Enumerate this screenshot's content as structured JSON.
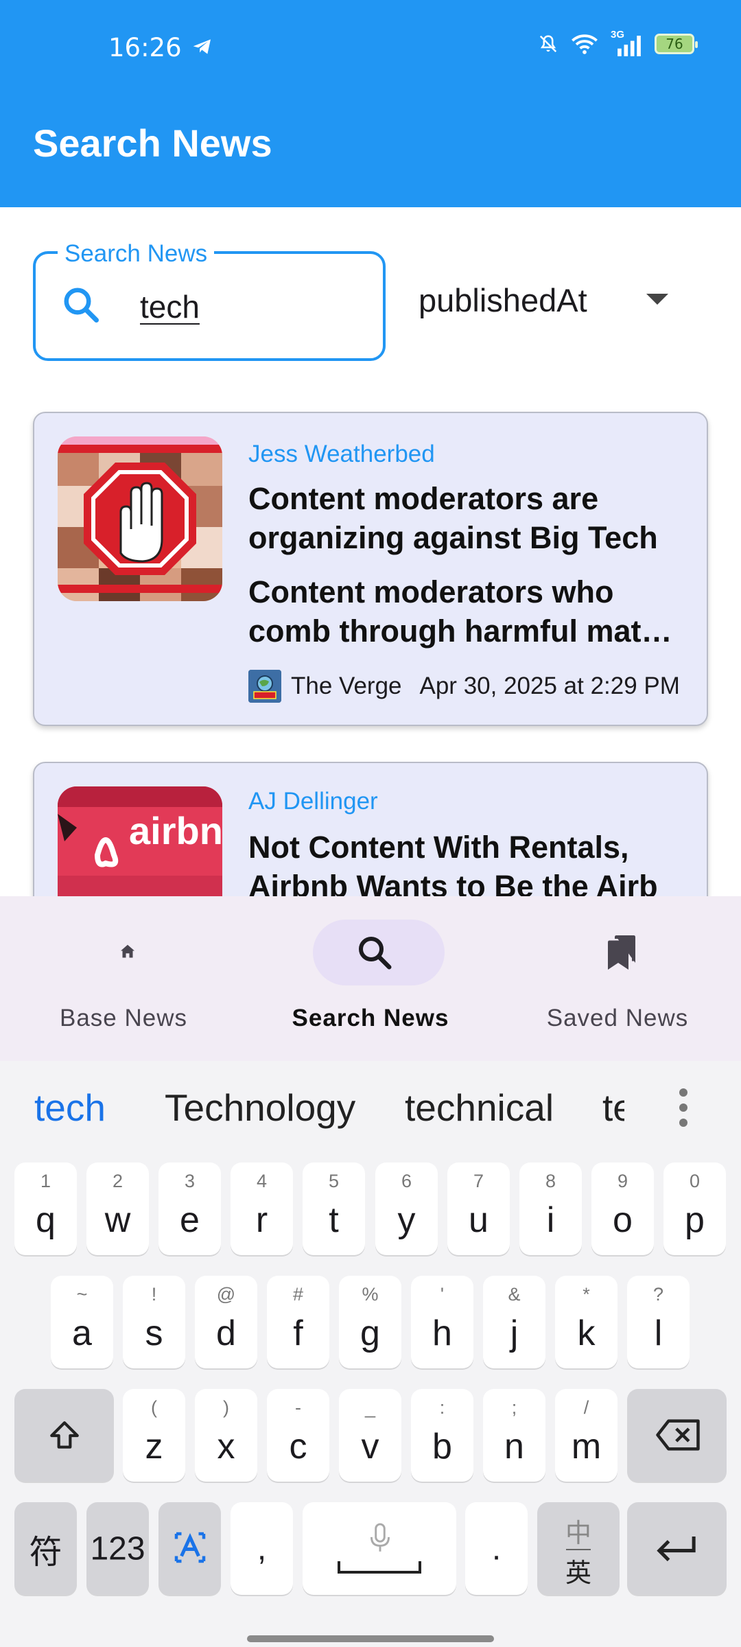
{
  "status_bar": {
    "time": "16:26",
    "network": "3G",
    "battery": "76",
    "icons": [
      "telegram-icon",
      "mute-bell-icon",
      "wifi-icon",
      "signal-icon",
      "battery-icon"
    ]
  },
  "app_bar": {
    "title": "Search News",
    "color": "#2196f3"
  },
  "search": {
    "label": "Search News",
    "value": "tech",
    "icon": "search-icon"
  },
  "sort": {
    "selected": "publishedAt"
  },
  "articles": [
    {
      "author": "Jess Weatherbed",
      "title": "Content moderators are organizing against Big Tech",
      "description_line1": "Content moderators who",
      "description_line2": "comb through harmful mat…",
      "source": "The Verge",
      "published": "Apr 30, 2025 at 2:29 PM",
      "thumbnail": "stop-hand-pixelated-image"
    },
    {
      "author": "AJ Dellinger",
      "title": "Not Content With Rentals, Airbnb Wants to Be the Airb",
      "thumbnail": "airbnb-logo-image",
      "thumb_text": "airbn"
    }
  ],
  "bottom_nav": {
    "items": [
      {
        "label": "Base News",
        "icon": "home-icon",
        "active": false
      },
      {
        "label": "Search News",
        "icon": "search-icon",
        "active": true
      },
      {
        "label": "Saved News",
        "icon": "bookmarks-icon",
        "active": false
      }
    ]
  },
  "keyboard": {
    "suggestions": [
      "tech",
      "Technology",
      "technical",
      "te"
    ],
    "row1": [
      {
        "hint": "1",
        "key": "q"
      },
      {
        "hint": "2",
        "key": "w"
      },
      {
        "hint": "3",
        "key": "e"
      },
      {
        "hint": "4",
        "key": "r"
      },
      {
        "hint": "5",
        "key": "t"
      },
      {
        "hint": "6",
        "key": "y"
      },
      {
        "hint": "7",
        "key": "u"
      },
      {
        "hint": "8",
        "key": "i"
      },
      {
        "hint": "9",
        "key": "o"
      },
      {
        "hint": "0",
        "key": "p"
      }
    ],
    "row2": [
      {
        "hint": "~",
        "key": "a"
      },
      {
        "hint": "!",
        "key": "s"
      },
      {
        "hint": "@",
        "key": "d"
      },
      {
        "hint": "#",
        "key": "f"
      },
      {
        "hint": "%",
        "key": "g"
      },
      {
        "hint": "'",
        "key": "h"
      },
      {
        "hint": "&",
        "key": "j"
      },
      {
        "hint": "*",
        "key": "k"
      },
      {
        "hint": "?",
        "key": "l"
      }
    ],
    "row3": [
      {
        "hint": "(",
        "key": "z"
      },
      {
        "hint": ")",
        "key": "x"
      },
      {
        "hint": "-",
        "key": "c"
      },
      {
        "hint": "_",
        "key": "v"
      },
      {
        "hint": ":",
        "key": "b"
      },
      {
        "hint": ";",
        "key": "n"
      },
      {
        "hint": "/",
        "key": "m"
      }
    ],
    "symbols_label": "符",
    "numbers_label": "123",
    "comma": ",",
    "period": ".",
    "lang_top": "中",
    "lang_bottom": "英"
  }
}
